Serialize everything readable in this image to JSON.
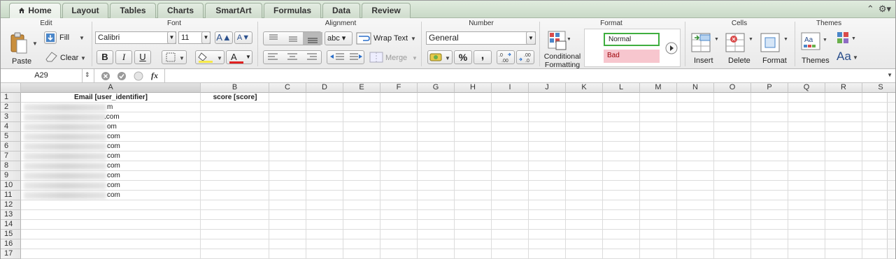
{
  "tabs": [
    {
      "label": "Home",
      "active": true
    },
    {
      "label": "Layout"
    },
    {
      "label": "Tables"
    },
    {
      "label": "Charts"
    },
    {
      "label": "SmartArt"
    },
    {
      "label": "Formulas"
    },
    {
      "label": "Data"
    },
    {
      "label": "Review"
    }
  ],
  "ribbon": {
    "edit": {
      "title": "Edit",
      "paste": "Paste",
      "fill": "Fill",
      "clear": "Clear"
    },
    "font": {
      "title": "Font",
      "name": "Calibri",
      "size": "11",
      "bold": "B",
      "italic": "I",
      "underline": "U",
      "grow": "A",
      "shrink": "A",
      "font_color_letter": "A"
    },
    "alignment": {
      "title": "Alignment",
      "wrap_text": "Wrap Text",
      "merge": "Merge",
      "abc": "abc"
    },
    "number": {
      "title": "Number",
      "format": "General",
      "percent": "%",
      "comma": ",",
      "inc_decimals": ".0 .00",
      "dec_decimals": ".00 .0"
    },
    "format": {
      "title": "Format",
      "conditional": "Conditional\nFormatting",
      "conditional_line1": "Conditional",
      "conditional_line2": "Formatting",
      "style_normal": "Normal",
      "style_bad": "Bad"
    },
    "cells": {
      "title": "Cells",
      "insert": "Insert",
      "delete": "Delete",
      "format": "Format"
    },
    "themes": {
      "title": "Themes",
      "themes": "Themes",
      "fonts_glyph": "Aa"
    }
  },
  "formula_bar": {
    "name_box": "A29",
    "fx": "fx",
    "value": ""
  },
  "columns": [
    "A",
    "B",
    "C",
    "D",
    "E",
    "F",
    "G",
    "H",
    "I",
    "J",
    "K",
    "L",
    "M",
    "N",
    "O",
    "P",
    "Q",
    "R",
    "S"
  ],
  "rows": [
    "1",
    "2",
    "3",
    "4",
    "5",
    "6",
    "7",
    "8",
    "9",
    "10",
    "11",
    "12",
    "13",
    "14",
    "15",
    "16",
    "17"
  ],
  "cells": {
    "A1": "Email [user_identifier]",
    "B1": "score [score]",
    "A2": "m",
    "A3": ".com",
    "A4": "om",
    "A5": "com",
    "A6": "com",
    "A7": "com",
    "A8": "com",
    "A9": "com",
    "A10": "com",
    "A11": "com"
  },
  "colors": {
    "tabbar": "#cfdccd",
    "bad_fill": "#f7c6ce",
    "bad_text": "#9c0006",
    "normal_border": "#3fae3f",
    "font_color_bar": "#e02020",
    "highlight_bar": "#f5e84a"
  }
}
